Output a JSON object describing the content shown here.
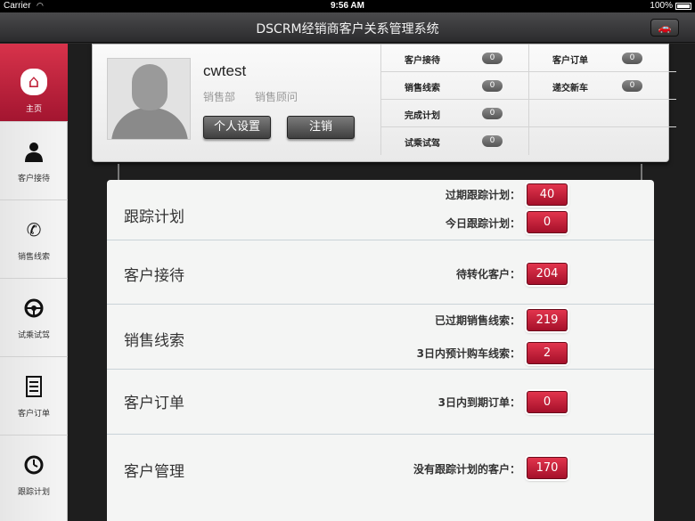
{
  "status_bar": {
    "carrier": "Carrier",
    "time": "9:56 AM",
    "battery": "100%"
  },
  "titlebar": {
    "title": "DSCRM经销商客户关系管理系统"
  },
  "sidebar": {
    "items": [
      {
        "label": "主页",
        "icon": "home-icon",
        "active": true
      },
      {
        "label": "客户接待",
        "icon": "person-icon"
      },
      {
        "label": "销售线索",
        "icon": "phone-icon"
      },
      {
        "label": "试乘试驾",
        "icon": "steering-wheel-icon"
      },
      {
        "label": "客户订单",
        "icon": "document-icon"
      },
      {
        "label": "跟踪计划",
        "icon": "clock-icon"
      }
    ]
  },
  "profile": {
    "username": "cwtest",
    "department": "销售部",
    "role": "销售顾问",
    "settings_button": "个人设置",
    "logout_button": "注销"
  },
  "stats": [
    {
      "label": "客户接待",
      "value": "0"
    },
    {
      "label": "客户订单",
      "value": "0"
    },
    {
      "label": "销售线索",
      "value": "0"
    },
    {
      "label": "递交新车",
      "value": "0"
    },
    {
      "label": "完成计划",
      "value": "0"
    },
    {
      "label": "试乘试驾",
      "value": "0"
    }
  ],
  "dashboard": [
    {
      "title": "跟踪计划",
      "metrics": [
        {
          "label": "过期跟踪计划：",
          "value": "40"
        },
        {
          "label": "今日跟踪计划：",
          "value": "0"
        }
      ]
    },
    {
      "title": "客户接待",
      "metrics": [
        {
          "label": "待转化客户：",
          "value": "204"
        }
      ]
    },
    {
      "title": "销售线索",
      "metrics": [
        {
          "label": "已过期销售线索：",
          "value": "219"
        },
        {
          "label": "3日内预计购车线索：",
          "value": "2"
        }
      ]
    },
    {
      "title": "客户订单",
      "metrics": [
        {
          "label": "3日内到期订单：",
          "value": "0"
        }
      ]
    },
    {
      "title": "客户管理",
      "metrics": [
        {
          "label": "没有跟踪计划的客户：",
          "value": "170"
        }
      ]
    }
  ],
  "colors": {
    "accent": "#c0223a",
    "badge_gray": "#6e6e6e"
  }
}
